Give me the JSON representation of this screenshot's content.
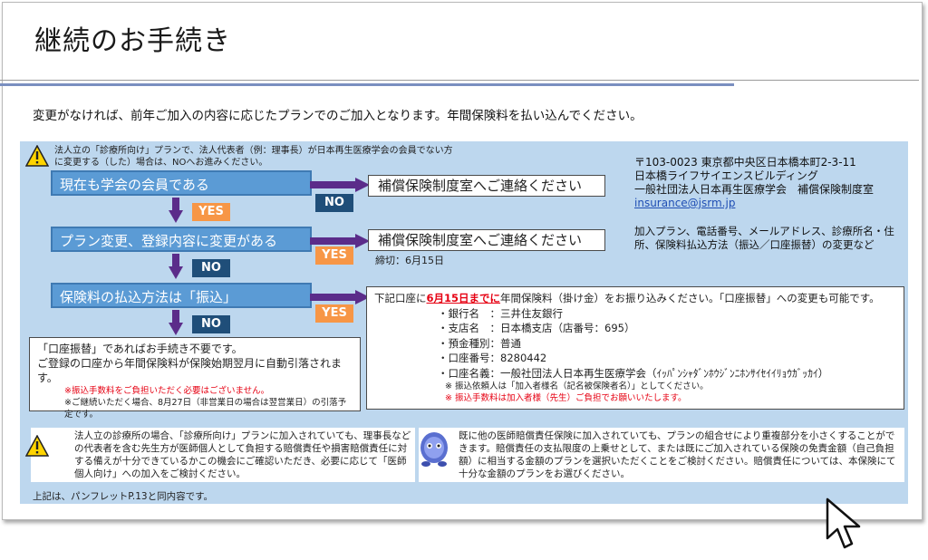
{
  "title": "継続のお手続き",
  "intro": "変更がなければ、前年ご加入の内容に応じたプランでのご加入となります。年間保険料を払い込んでください。",
  "note_top": "法人立の「診療所向け」プランで、法人代表者（例：理事長）が日本再生医療学会の会員でない方に変更する（した）場合は、NOへお進みください。",
  "steps": [
    "現在も学会の会員である",
    "プラン変更、登録内容に変更がある",
    "保険料の払込方法は「振込」"
  ],
  "contact_box": "補償保険制度室へご連絡ください",
  "contact_box_2": "補償保険制度室へご連絡ください",
  "deadline": "締切：6月15日",
  "tags": {
    "yes": "YES",
    "no": "NO"
  },
  "address": {
    "line1": "〒103-0023 東京都中央区日本橋本町2-3-11",
    "line2": "日本橋ライフサイエンスビルディング",
    "line3": "一般社団法人日本再生医療学会　補償保険制度室",
    "email": "insurance@jsrm.jp"
  },
  "change_note": "加入プラン、電話番号、メールアドレス、診療所名・住所、保険料払込方法（振込／口座振替）の変更など",
  "transfer": {
    "lead_pre": "下記口座に",
    "lead_red": "6月15日までに",
    "lead_post": "年間保険料（掛け金）をお振り込みください。「口座振替」への変更も可能です。",
    "bank": "・銀行名　：三井住友銀行",
    "branch": "・支店名　：日本橋支店（店番号：695）",
    "type": "・預金種別：普通",
    "number": "・口座番号：8280442",
    "holder": "・口座名義：一般社団法人日本再生医療学会（ｲｯﾊﾟﾝｼｬﾀﾞﾝﾎｳｼﾞﾝﾆﾎﾝｻｲｾｲｲﾘｮｳｶﾞｯｶｲ）",
    "note1": "※ 振込依頼人は「加入者様名（記名被保険者名）」としてください。",
    "note2": "※ 振込手数料は加入者様（先生）ご負担でお願いいたします。"
  },
  "furikae": {
    "line1": "「口座振替」であればお手続き不要です。",
    "line2": "ご登録の口座から年間保険料が保険始期翌月に自動引落されます。",
    "note_red": "※振込手数料をご負担いただく必要はございません。",
    "note": "※ご継続いただく場合、8月27日（非営業日の場合は翌営業日）の引落予定です。"
  },
  "bottom_left": "法人立の診療所の場合、「診療所向け」プランに加入されていても、理事長などの代表者を含む先生方が医師個人として負担する賠償責任や損害賠償責任に対する備えが十分できているかこの機会にご確認いただき、必要に応じて「医師個人向け」への加入をご検討ください。",
  "bottom_right": "既に他の医師賠償責任保険に加入されていても、プランの組合せにより重複部分を小さくすることができます。賠償責任の支払限度の上乗せとして、または既にご加入されている保険の免責金額（自己負担額）に相当する金額のプランを選択いただくことをご検討ください。賠償責任については、本保険にて十分な金額のプランをお選びください。",
  "footnote": "上記は、パンフレットP.13と同内容です。",
  "colors": {
    "panel": "#bdd7ee",
    "step": "#5b9bd5",
    "arrow": "#5b2c8a",
    "yes": "#f79646",
    "no": "#1f4e79"
  }
}
